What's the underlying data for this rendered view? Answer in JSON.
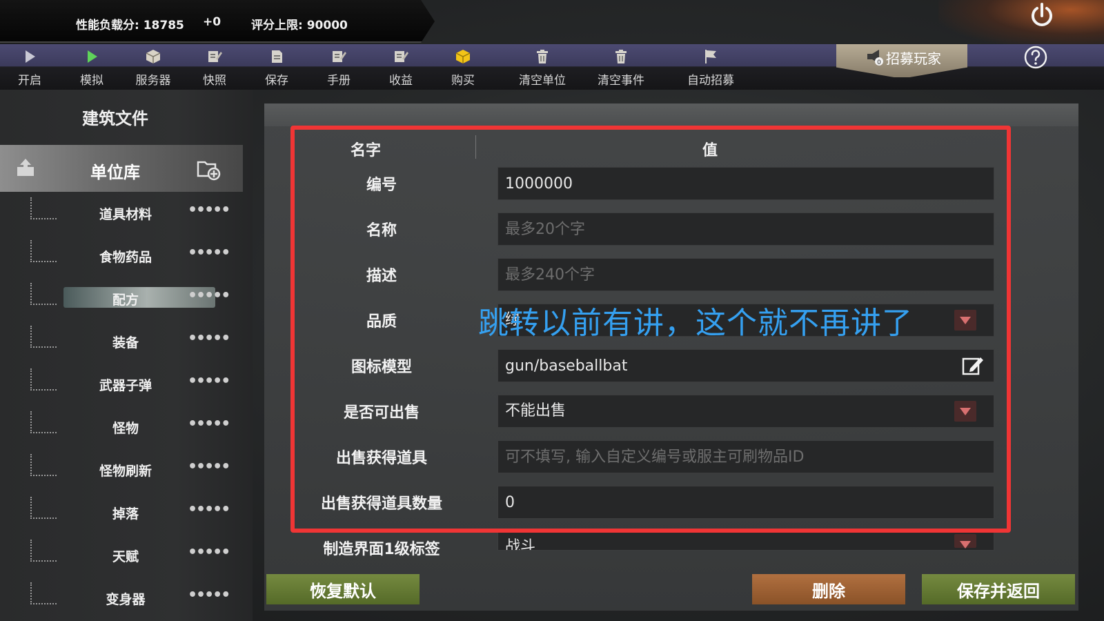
{
  "scorebar": {
    "load_label": "性能负载分: 18785",
    "delta": "+0",
    "limit_label": "评分上限: 90000"
  },
  "toolbar": {
    "items": [
      {
        "label": "开启",
        "icon": "play-icon"
      },
      {
        "label": "模拟",
        "icon": "play-green-icon"
      },
      {
        "label": "服务器",
        "icon": "box-icon"
      },
      {
        "label": "快照",
        "icon": "edit-icon"
      },
      {
        "label": "保存",
        "icon": "save-icon"
      },
      {
        "label": "手册",
        "icon": "edit-icon"
      },
      {
        "label": "收益",
        "icon": "edit-icon"
      },
      {
        "label": "购买",
        "icon": "cube-icon"
      },
      {
        "label": "清空单位",
        "icon": "trash-icon"
      },
      {
        "label": "清空事件",
        "icon": "trash-icon"
      },
      {
        "label": "自动招募",
        "icon": "flag-icon"
      }
    ],
    "recruit_label": "招募玩家",
    "recruit_badge": "0"
  },
  "sidebar": {
    "title": "建筑文件",
    "unit_library": "单位库",
    "items": [
      {
        "label": "道具材料"
      },
      {
        "label": "食物药品"
      },
      {
        "label": "配方"
      },
      {
        "label": "装备"
      },
      {
        "label": "武器子弹"
      },
      {
        "label": "怪物"
      },
      {
        "label": "怪物刷新"
      },
      {
        "label": "掉落"
      },
      {
        "label": "天赋"
      },
      {
        "label": "变身器"
      }
    ],
    "dots": "•••••"
  },
  "form": {
    "col_name": "名字",
    "col_value": "值",
    "rows": [
      {
        "label": "编号",
        "value": "1000000",
        "placeholder": ""
      },
      {
        "label": "名称",
        "value": "",
        "placeholder": "最多20个字"
      },
      {
        "label": "描述",
        "value": "",
        "placeholder": "最多240个字"
      },
      {
        "label": "品质",
        "value": "绿",
        "placeholder": ""
      },
      {
        "label": "图标模型",
        "value": "gun/baseballbat",
        "placeholder": ""
      },
      {
        "label": "是否可出售",
        "value": "不能出售",
        "placeholder": ""
      },
      {
        "label": "出售获得道具",
        "value": "",
        "placeholder": "可不填写, 输入自定义编号或服主可刷物品ID"
      },
      {
        "label": "出售获得道具数量",
        "value": "0",
        "placeholder": ""
      },
      {
        "label": "制造界面1级标签",
        "value": "战斗",
        "placeholder": ""
      }
    ],
    "annotation": "跳转以前有讲，这个就不再讲了"
  },
  "buttons": {
    "restore": "恢复默认",
    "delete": "删除",
    "save_return": "保存并返回"
  },
  "colors": {
    "highlight_box": "#f03535",
    "annotation": "#35a0f0",
    "green_button": "#6a7f36",
    "orange_button": "#a0643a"
  }
}
